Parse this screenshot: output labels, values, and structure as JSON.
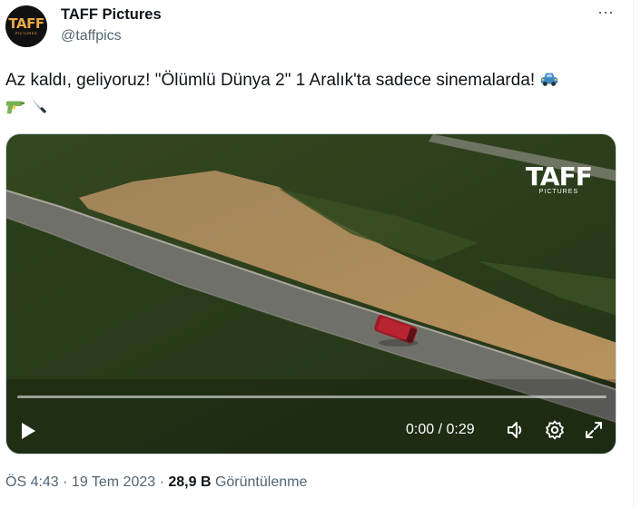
{
  "author": {
    "display_name": "TAFF Pictures",
    "handle": "@taffpics",
    "avatar_text": "TAFF",
    "avatar_subtext": "PICTURES"
  },
  "more_icon": "⋯",
  "tweet": {
    "text": "Az kaldı, geliyoruz!  \"Ölümlü Dünya 2\" 1 Aralık'ta sadece sinemalarda!",
    "emojis": [
      "car-icon",
      "water-pistol-icon",
      "knife-icon"
    ]
  },
  "video": {
    "watermark_main": "TAFF",
    "watermark_sub": "PICTURES",
    "time_display": "0:00 / 0:29",
    "progress": 0
  },
  "meta": {
    "time": "ÖS 4:43",
    "separator": " · ",
    "date": "19 Tem 2023",
    "views_count": "28,9 B",
    "views_label": "Görüntülenme"
  },
  "colors": {
    "text_primary": "#0f1419",
    "text_secondary": "#536471",
    "avatar_accent": "#e9a94a"
  }
}
